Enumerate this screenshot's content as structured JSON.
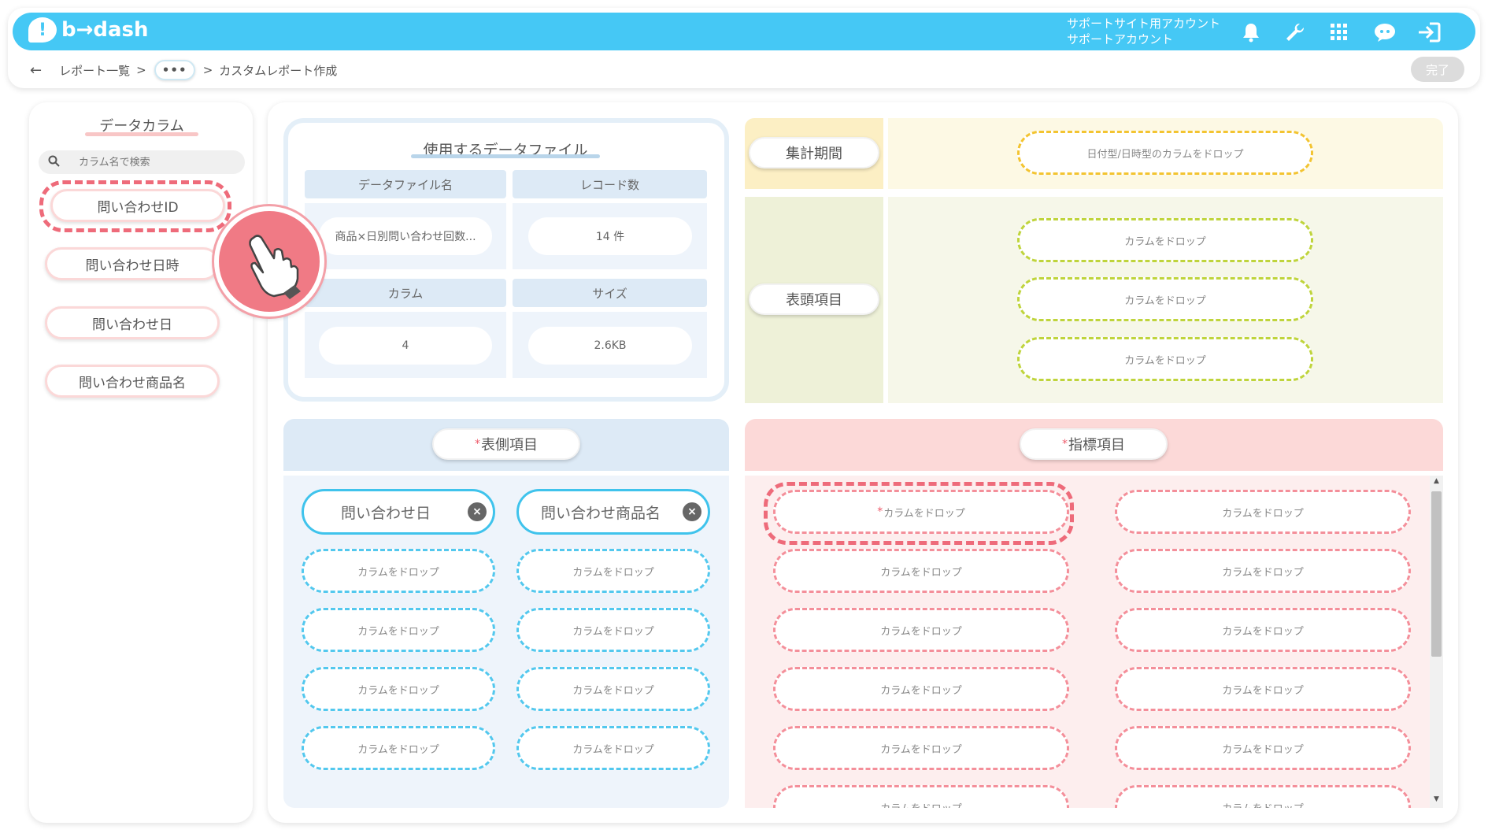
{
  "header": {
    "brand": "b→dash",
    "account_line1": "サポートサイト用アカウント",
    "account_line2": "サポートアカウント",
    "icons": [
      "bell-icon",
      "wrench-icon",
      "grid-icon",
      "chat-bot-icon",
      "logout-icon"
    ]
  },
  "breadcrumb": {
    "back": "←",
    "item1": "レポート一覧",
    "sep": ">",
    "more": "•••",
    "current": "カスタムレポート作成"
  },
  "done_label": "完了",
  "sidebar": {
    "title": "データカラム",
    "search_placeholder": "カラム名で検索",
    "columns": [
      "問い合わせID",
      "問い合わせ日時",
      "問い合わせ日",
      "問い合わせ商品名"
    ]
  },
  "datafile": {
    "title": "使用するデータファイル",
    "name_header": "データファイル名",
    "records_header": "レコード数",
    "columns_header": "カラム",
    "size_header": "サイズ",
    "name_value": "商品×日別問い合わせ回数...",
    "records_value": "14 件",
    "columns_value": "4",
    "size_value": "2.6KB"
  },
  "period": {
    "label": "集計期間",
    "drop_label": "日付型/日時型のカラムをドロップ"
  },
  "header_items": {
    "label": "表頭項目",
    "drops": [
      "カラムをドロップ",
      "カラムをドロップ",
      "カラムをドロップ"
    ]
  },
  "side_items": {
    "label": "表側項目",
    "required_mark": "*",
    "filled": [
      "問い合わせ日",
      "問い合わせ商品名"
    ],
    "remove": "×",
    "drop_label": "カラムをドロップ"
  },
  "metric_items": {
    "label": "指標項目",
    "required_mark": "*",
    "drop_label": "カラムをドロップ"
  },
  "colors": {
    "brand": "#45c8f5",
    "highlight": "#ee6b7a"
  }
}
